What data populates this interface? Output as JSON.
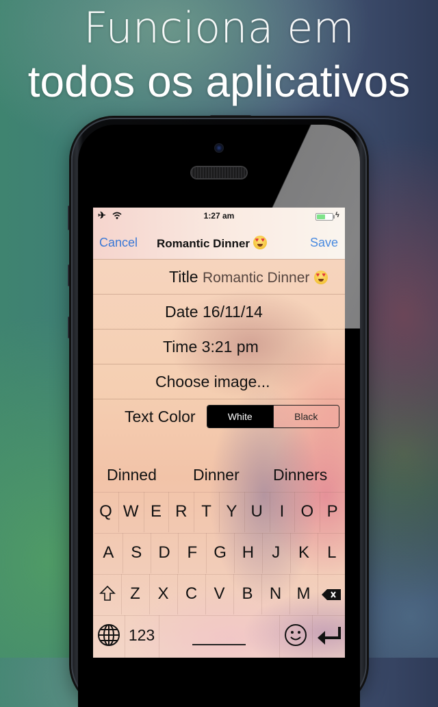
{
  "headline": {
    "line1": "Funciona em",
    "line2": "todos os aplicativos"
  },
  "status_bar": {
    "time": "1:27 am",
    "airplane_icon": "airplane-icon",
    "wifi_icon": "wifi-icon",
    "battery_level": 0.55,
    "battery_color": "#7fe38a",
    "charging_icon": "bolt-icon"
  },
  "navbar": {
    "cancel_label": "Cancel",
    "title": "Romantic Dinner",
    "title_emoji": "heart-eyes-emoji",
    "save_label": "Save",
    "accent_color": "#3a78d6"
  },
  "form": {
    "title_label": "Title",
    "title_value": "Romantic Dinner",
    "date_label": "Date",
    "date_value": "16/11/14",
    "time_label": "Time",
    "time_value": "3:21 pm",
    "choose_image_label": "Choose image...",
    "text_color_label": "Text Color",
    "text_color_options": [
      "White",
      "Black"
    ],
    "text_color_selected": "White"
  },
  "keyboard": {
    "suggestions": [
      "Dinned",
      "Dinner",
      "Dinners"
    ],
    "row1": [
      "Q",
      "W",
      "E",
      "R",
      "T",
      "Y",
      "U",
      "I",
      "O",
      "P"
    ],
    "row2": [
      "A",
      "S",
      "D",
      "F",
      "G",
      "H",
      "J",
      "K",
      "L"
    ],
    "row3": [
      "Z",
      "X",
      "C",
      "V",
      "B",
      "N",
      "M"
    ],
    "numbers_label": "123",
    "shift_icon": "shift-icon",
    "delete_icon": "backspace-icon",
    "globe_icon": "globe-icon",
    "emoji_icon": "smiley-icon",
    "return_icon": "return-icon"
  }
}
